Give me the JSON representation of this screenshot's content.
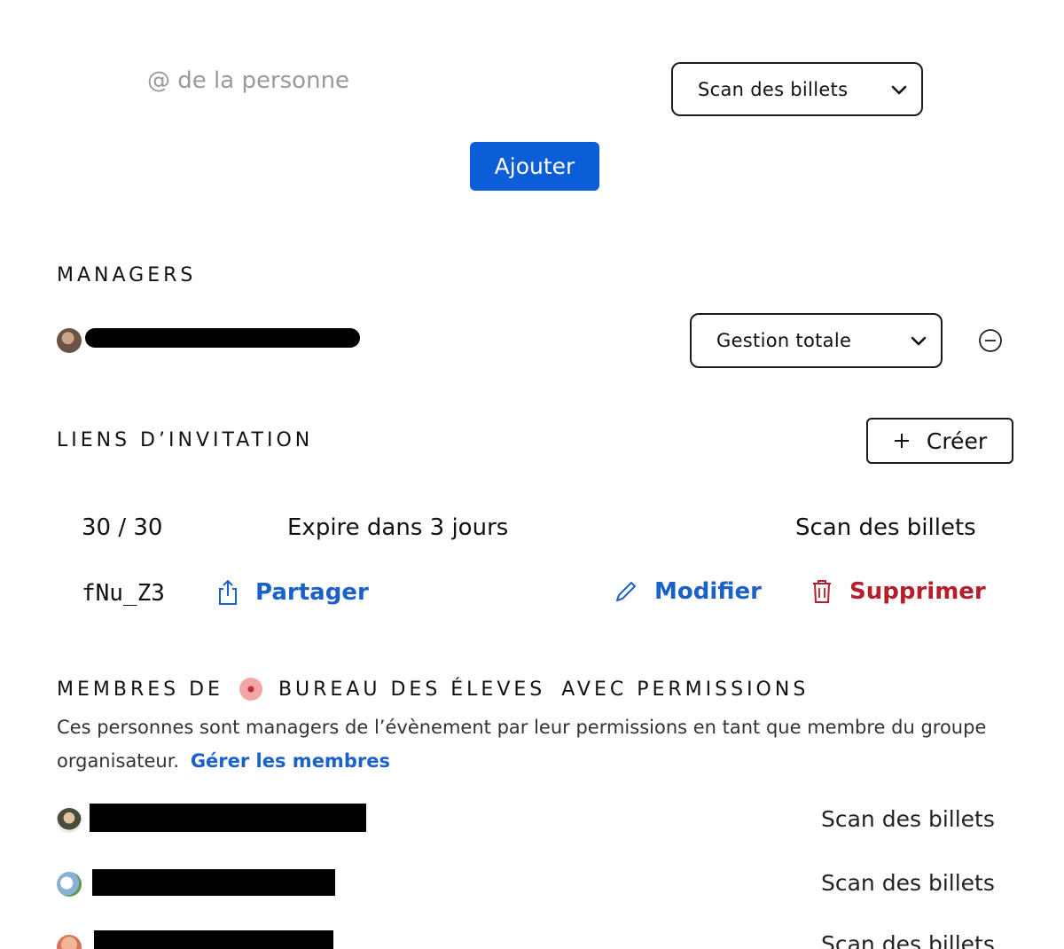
{
  "add_person": {
    "input_placeholder": "@ de la personne",
    "role_select": "Scan des billets",
    "add_button": "Ajouter"
  },
  "managers": {
    "title": "MANAGERS",
    "items": [
      {
        "role": "Gestion totale"
      }
    ]
  },
  "invites": {
    "title": "LIENS D’INVITATION",
    "create_button": "Créer",
    "link": {
      "usage": "30 / 30",
      "expiry": "Expire dans 3 jours",
      "role": "Scan des billets",
      "code": "fNu_Z3",
      "share_label": "Partager",
      "edit_label": "Modifier",
      "delete_label": "Supprimer"
    }
  },
  "members": {
    "title_prefix": "MEMBRES DE",
    "group_name": "BUREAU DES ÉLEVES",
    "title_suffix": "AVEC PERMISSIONS",
    "description": "Ces personnes sont managers de l’évènement par leur permissions en tant que membre du groupe organisateur.",
    "manage_link": "Gérer les membres",
    "items": [
      {
        "role": "Scan des billets"
      },
      {
        "role": "Scan des billets"
      },
      {
        "role": "Scan des billets"
      }
    ]
  },
  "colors": {
    "primary": "#0b5ed7",
    "link": "#1a62c7",
    "danger": "#b51e2a"
  },
  "icons": [
    "chevron-down-icon",
    "remove-circle-icon",
    "plus-icon",
    "share-icon",
    "pencil-icon",
    "trash-icon"
  ]
}
